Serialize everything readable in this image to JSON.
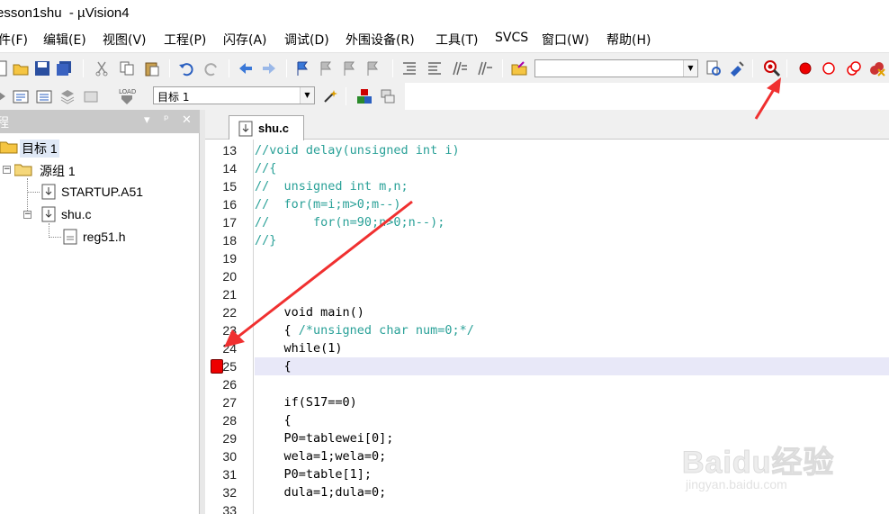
{
  "window": {
    "title": "esson1shu  - µVision4"
  },
  "menubar": {
    "items": [
      {
        "label": "件(F)"
      },
      {
        "label": "编辑(E)"
      },
      {
        "label": "视图(V)"
      },
      {
        "label": "工程(P)"
      },
      {
        "label": "闪存(A)"
      },
      {
        "label": "调试(D)"
      },
      {
        "label": "外围设备(R)"
      },
      {
        "label": "工具(T)"
      },
      {
        "label": "SVCS"
      },
      {
        "label": "窗口(W)"
      },
      {
        "label": "帮助(H)"
      }
    ]
  },
  "toolbar2": {
    "target_value": "目标 1"
  },
  "project_panel": {
    "title": "程",
    "pin_glyph": "ᵖ",
    "dropdown_glyph": "▾",
    "close_glyph": "✕",
    "tree": {
      "target": "目标 1",
      "group": "源组 1",
      "files": [
        "STARTUP.A51",
        "shu.c"
      ],
      "includes": [
        "reg51.h"
      ]
    }
  },
  "editor": {
    "tab_label": "shu.c",
    "highlight_line": 25,
    "breakpoint_line": 25,
    "lines": [
      {
        "n": "13",
        "text": "//void delay(unsigned int i)",
        "kind": "comment"
      },
      {
        "n": "14",
        "text": "//{",
        "kind": "comment"
      },
      {
        "n": "15",
        "text": "//  unsigned int m,n;",
        "kind": "comment"
      },
      {
        "n": "16",
        "text": "//  for(m=i;m>0;m--)",
        "kind": "comment"
      },
      {
        "n": "17",
        "text": "//      for(n=90;n>0;n--);",
        "kind": "comment"
      },
      {
        "n": "18",
        "text": "//}",
        "kind": "comment"
      },
      {
        "n": "19",
        "text": "",
        "kind": "plain"
      },
      {
        "n": "20",
        "text": "",
        "kind": "plain"
      },
      {
        "n": "21",
        "text": "",
        "kind": "plain"
      },
      {
        "n": "22",
        "text": "    void main()",
        "kind": "plain"
      },
      {
        "n": "23",
        "text": "    { /*unsigned char num=0;*/",
        "kind": "mixed"
      },
      {
        "n": "24",
        "text": "    while(1)",
        "kind": "plain"
      },
      {
        "n": "25",
        "text": "    {",
        "kind": "plain"
      },
      {
        "n": "26",
        "text": "",
        "kind": "plain"
      },
      {
        "n": "27",
        "text": "    if(S17==0)",
        "kind": "plain"
      },
      {
        "n": "28",
        "text": "    {",
        "kind": "plain"
      },
      {
        "n": "29",
        "text": "    P0=tablewei[0];",
        "kind": "plain"
      },
      {
        "n": "30",
        "text": "    wela=1;wela=0;",
        "kind": "plain"
      },
      {
        "n": "31",
        "text": "    P0=table[1];",
        "kind": "plain"
      },
      {
        "n": "32",
        "text": "    dula=1;dula=0;",
        "kind": "plain"
      },
      {
        "n": "33",
        "text": "",
        "kind": "plain"
      }
    ]
  },
  "watermark": {
    "logo": "Baidu经验",
    "url": "jingyan.baidu.com"
  },
  "colors": {
    "comment": "#2aa198",
    "keyword": "#000000",
    "highlight": "#e8e8f8",
    "breakpoint": "#e00000",
    "annotation_arrow": "#f03030"
  }
}
